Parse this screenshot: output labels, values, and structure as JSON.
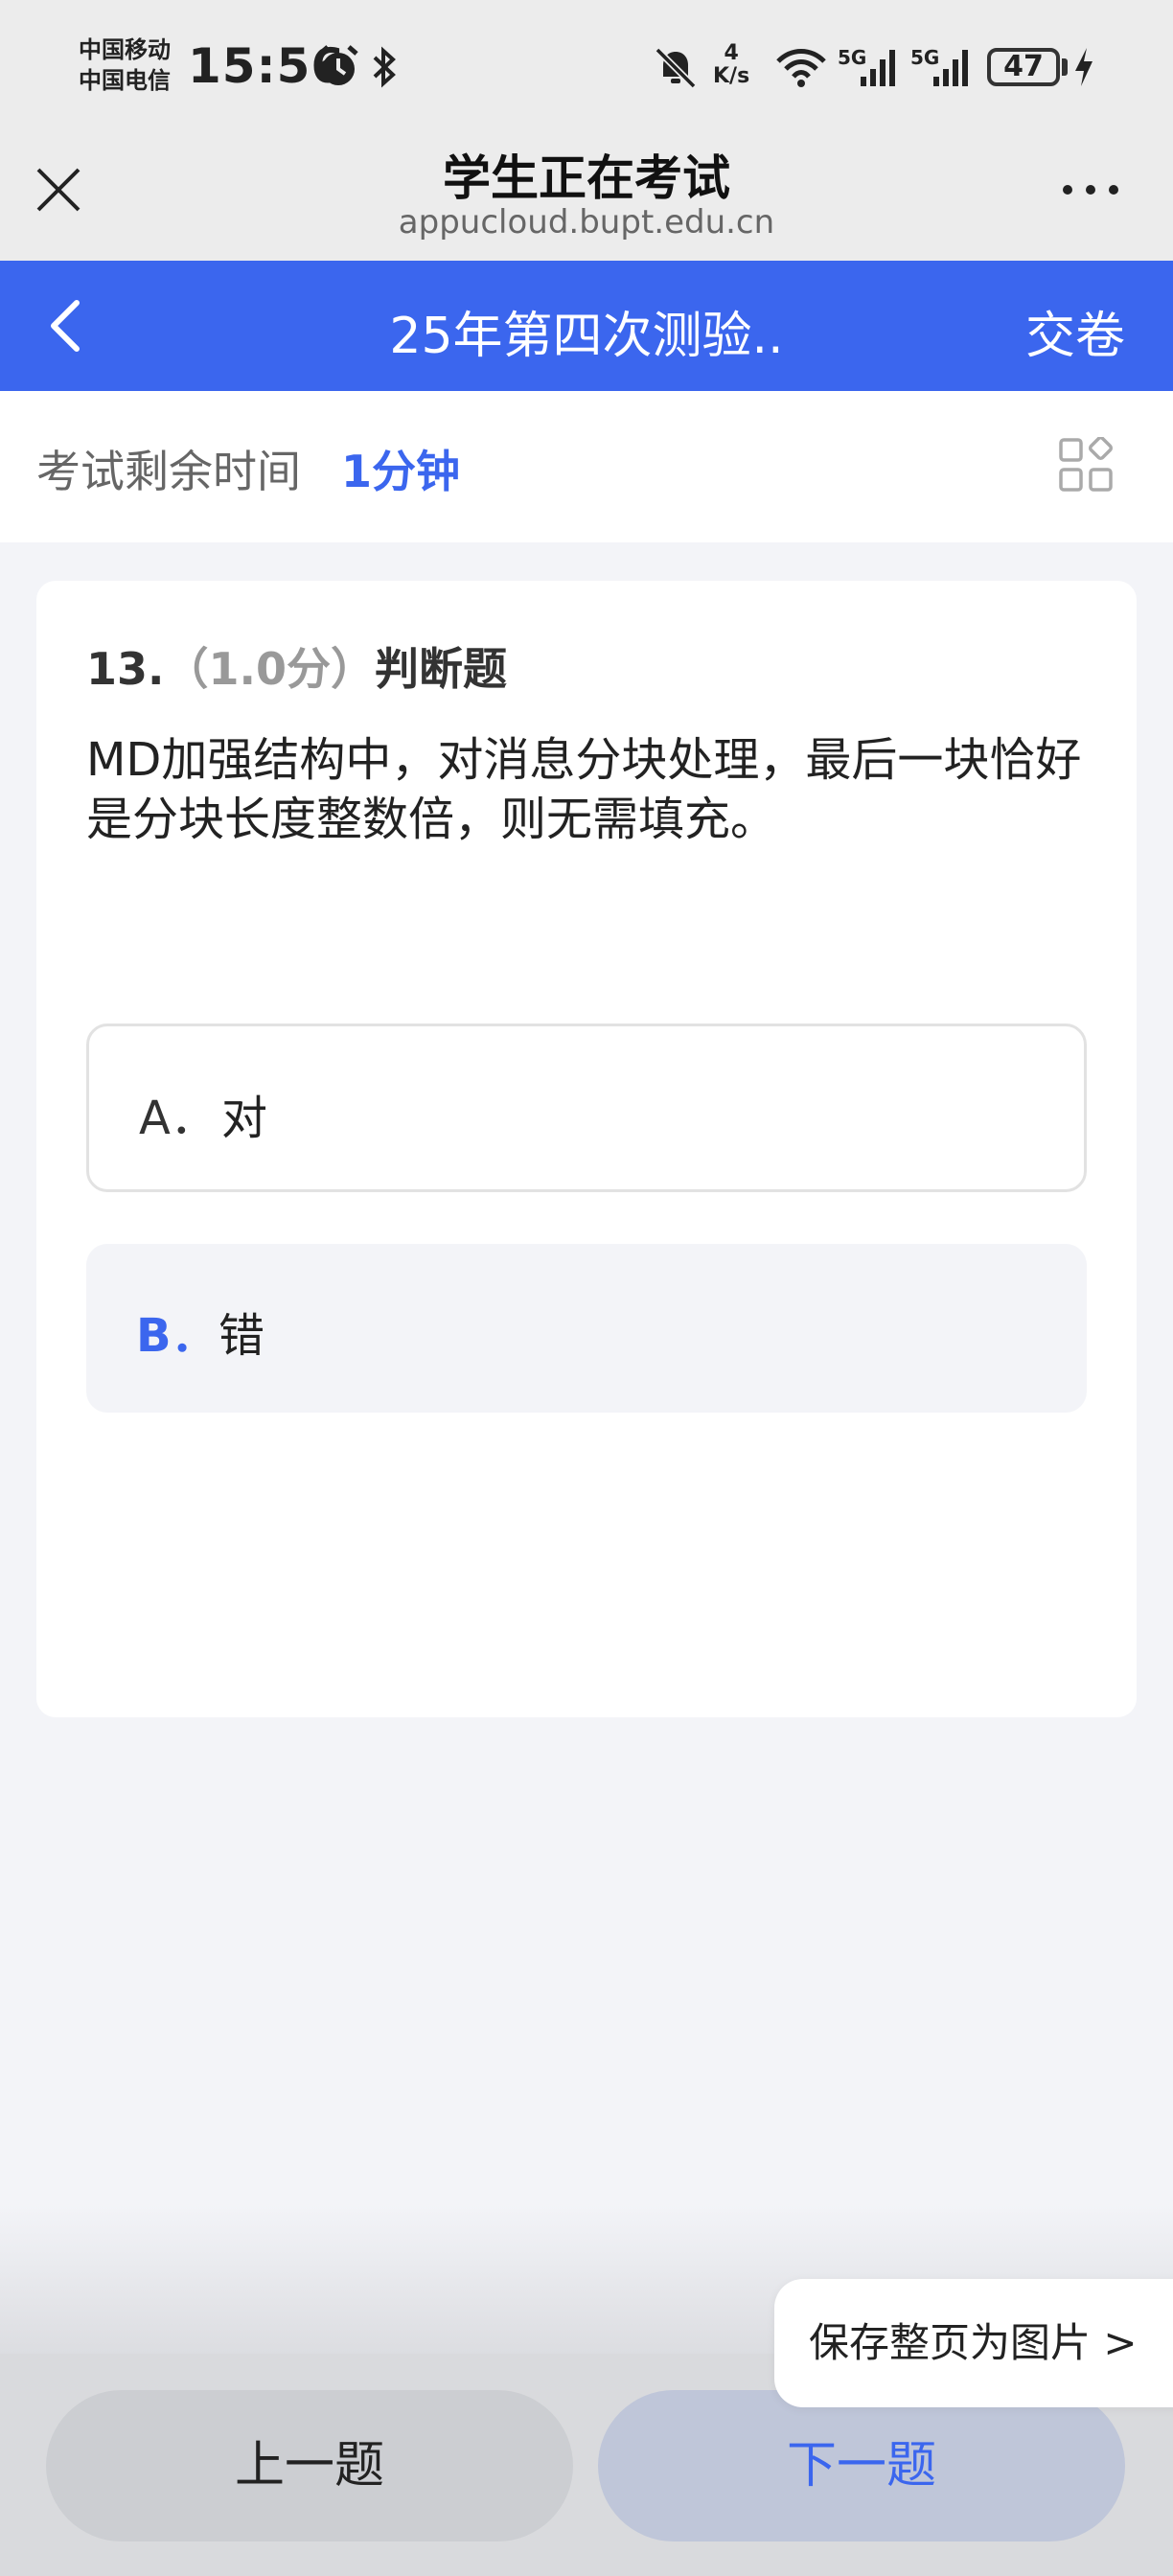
{
  "status_bar": {
    "carrier_1": "中国移动",
    "carrier_2": "中国电信",
    "time": "15:56",
    "net_speed_value": "4",
    "net_speed_unit": "K/s",
    "signal_1": "5G",
    "signal_2": "5G",
    "battery": "47",
    "icons": [
      "alarm-icon",
      "bluetooth-icon",
      "mute-icon",
      "wifi-icon",
      "signal-icon",
      "battery-icon",
      "charging-icon"
    ]
  },
  "browser": {
    "title": "学生正在考试",
    "url": "appucloud.bupt.edu.cn",
    "icons": [
      "close-icon",
      "more-icon"
    ]
  },
  "header": {
    "exam_title": "25年第四次测验..",
    "submit_label": "交卷",
    "background": "#3b66ee"
  },
  "timer": {
    "label": "考试剩余时间",
    "value": "1分钟"
  },
  "question": {
    "number": "13.",
    "score": "（1.0分）",
    "type": "判断题",
    "text": "MD加强结构中，对消息分块处理，最后一块恰好是分块长度整数倍，则无需填充。",
    "options": [
      {
        "letter": "A．",
        "text": "对",
        "selected": false
      },
      {
        "letter": "B．",
        "text": "错",
        "selected": true
      }
    ]
  },
  "footer": {
    "prev_label": "上一题",
    "next_label": "下一题",
    "save_label": "保存整页为图片 >"
  },
  "colors": {
    "accent": "#3b66ee",
    "page_bg": "#f3f4f8"
  }
}
